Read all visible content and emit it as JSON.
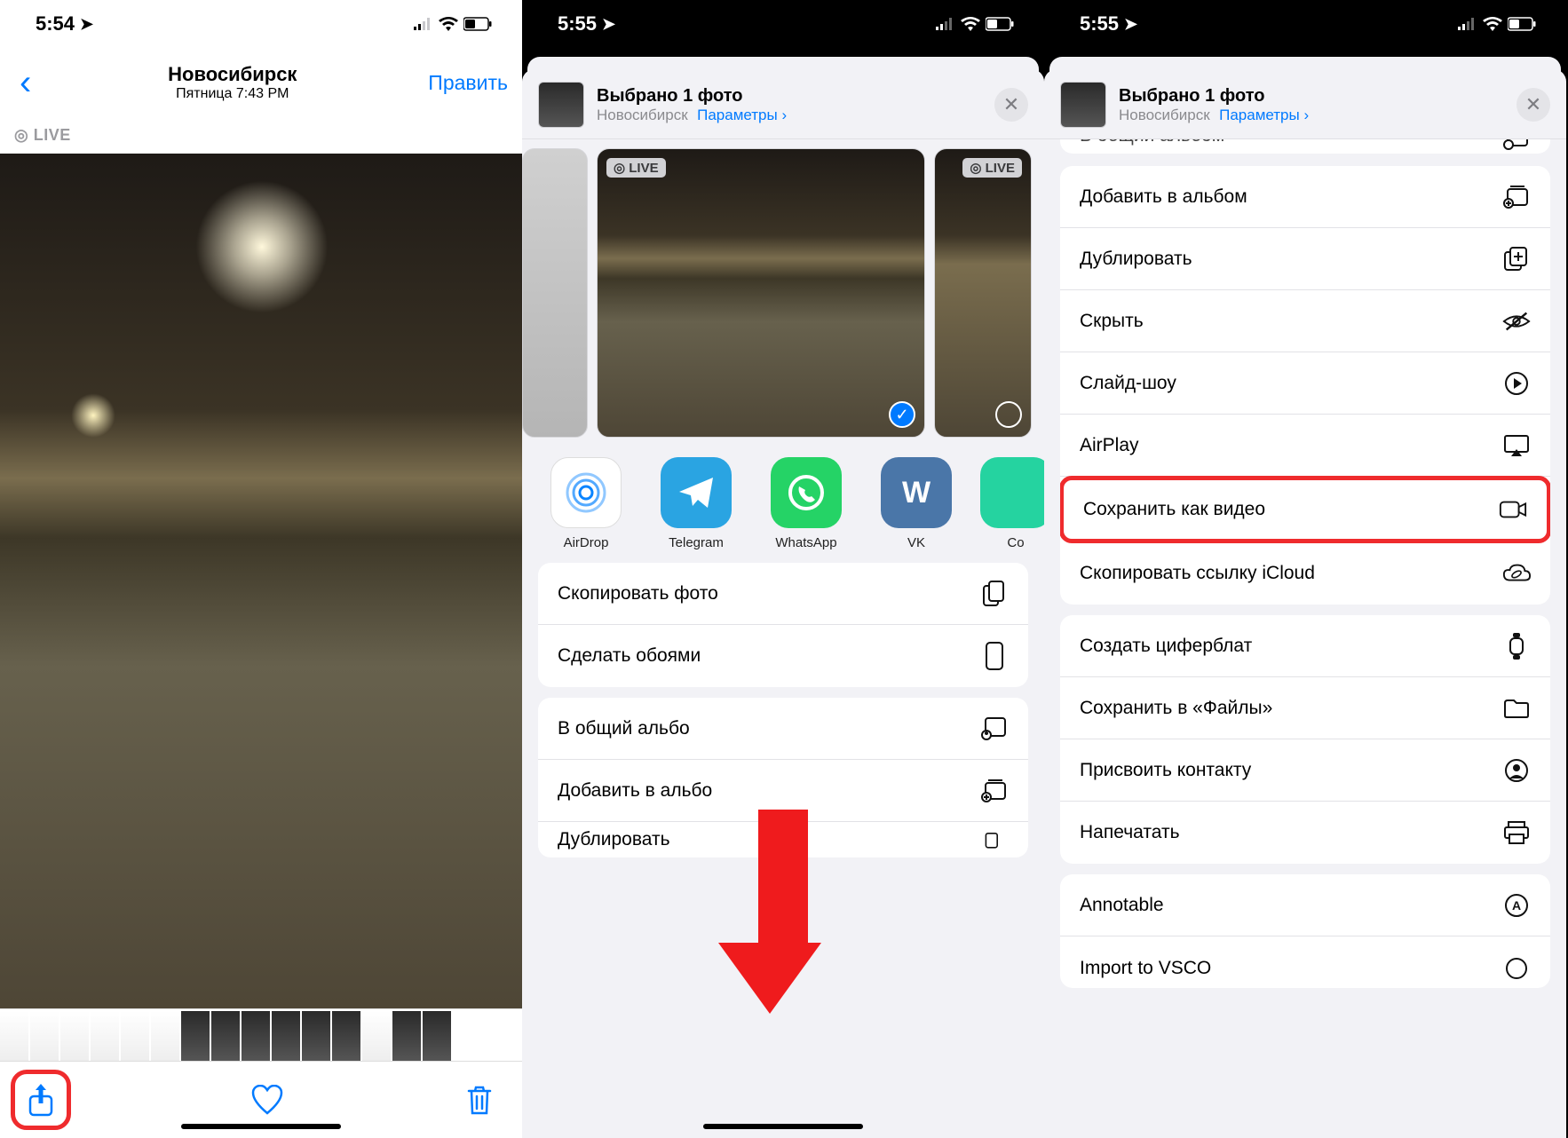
{
  "panel1": {
    "status_time": "5:54",
    "nav": {
      "city": "Новосибирск",
      "subtitle": "Пятница  7:43 PM",
      "edit": "Править"
    },
    "live_badge": "◎ LIVE"
  },
  "panel2": {
    "status_time": "5:55",
    "sheet_header": {
      "title": "Выбрано 1 фото",
      "location": "Новосибирск",
      "options": "Параметры",
      "chevron": "›"
    },
    "live_badge": "◎ LIVE",
    "apps": {
      "airdrop": "AirDrop",
      "telegram": "Telegram",
      "whatsapp": "WhatsApp",
      "vk": "VK",
      "next_partial": "Co"
    },
    "actions": {
      "copy_photo": "Скопировать фото",
      "set_wallpaper": "Сделать обоями",
      "shared_album": "В общий альбо",
      "add_album": "Добавить в альбо",
      "duplicate_partial": "Дублировать"
    }
  },
  "panel3": {
    "status_time": "5:55",
    "sheet_header": {
      "title": "Выбрано 1 фото",
      "location": "Новосибирск",
      "options": "Параметры",
      "chevron": "›"
    },
    "actions": {
      "shared_album_top": "В общий альбом",
      "add_album": "Добавить в альбом",
      "duplicate": "Дублировать",
      "hide": "Скрыть",
      "slideshow": "Слайд-шоу",
      "airplay": "AirPlay",
      "save_video": "Сохранить как видео",
      "copy_icloud": "Скопировать ссылку iCloud",
      "watch_face": "Создать циферблат",
      "save_files": "Сохранить в «Файлы»",
      "assign_contact": "Присвоить контакту",
      "print": "Напечатать",
      "annotable": "Annotable",
      "vsco": "Import to VSCO"
    }
  }
}
